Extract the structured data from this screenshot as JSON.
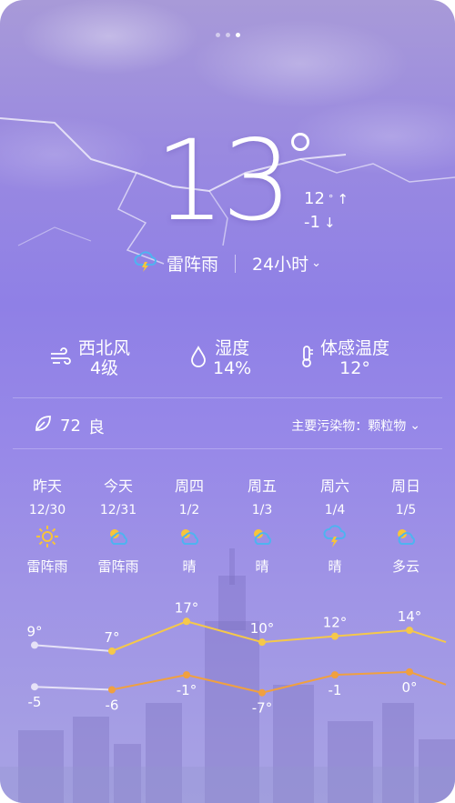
{
  "current": {
    "temperature": "13",
    "high": "12",
    "low": "-1",
    "condition": "雷阵雨",
    "range_toggle": "24小时"
  },
  "details": {
    "wind": {
      "label": "西北风",
      "value": "4级",
      "icon": "wind-icon"
    },
    "humidity": {
      "label": "湿度",
      "value": "14%",
      "icon": "drop-icon"
    },
    "feels_like": {
      "label": "体感温度",
      "value": "12°",
      "icon": "thermometer-icon"
    }
  },
  "air": {
    "aqi": "72",
    "level": "良",
    "pollutant_label": "主要污染物：颗粒物"
  },
  "forecast": [
    {
      "day": "昨天",
      "date": "12/30",
      "icon": "sun-icon",
      "condition": "雷阵雨"
    },
    {
      "day": "今天",
      "date": "12/31",
      "icon": "partly-cloudy-icon",
      "condition": "雷阵雨"
    },
    {
      "day": "周四",
      "date": "1/2",
      "icon": "partly-cloudy-icon",
      "condition": "晴"
    },
    {
      "day": "周五",
      "date": "1/3",
      "icon": "partly-cloudy-icon",
      "condition": "晴"
    },
    {
      "day": "周六",
      "date": "1/4",
      "icon": "thunder-rain-icon",
      "condition": "晴"
    },
    {
      "day": "周日",
      "date": "1/5",
      "icon": "partly-cloudy-icon",
      "condition": "多云"
    }
  ],
  "chart_data": {
    "type": "line",
    "categories": [
      "昨天",
      "今天",
      "周四",
      "周五",
      "周六",
      "周日"
    ],
    "series": [
      {
        "values": [
          9,
          7,
          17,
          10,
          12,
          14
        ],
        "color": "#f5c84a"
      },
      {
        "values": [
          -5,
          -6,
          -1,
          -7,
          -1,
          0
        ],
        "color": "#f0a040"
      }
    ],
    "labels_high": [
      "9°",
      "7°",
      "17°",
      "10°",
      "12°",
      "14°"
    ],
    "labels_low": [
      "-5",
      "-6",
      "-1°",
      "-7°",
      "-1",
      "0°"
    ],
    "past_color": "#e6e2f7"
  },
  "colors": {
    "background_top": "#a89ad8",
    "background_mid": "#8f80e6",
    "icon_yellow": "#f7c43a",
    "icon_blue": "#4fb3f0"
  }
}
